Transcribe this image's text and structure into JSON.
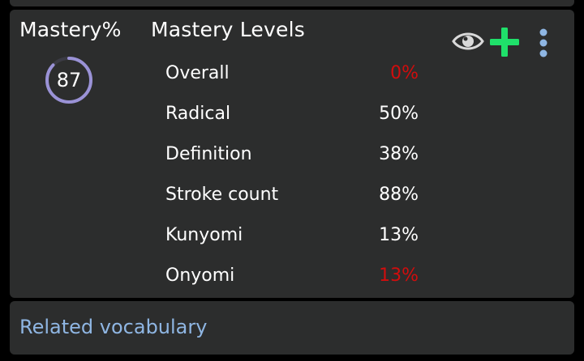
{
  "mastery": {
    "title": "Mastery%",
    "value": "87",
    "ring_fraction": 0.87,
    "ring_color": "#9a92d6"
  },
  "levels": {
    "title": "Mastery Levels",
    "items": [
      {
        "label": "Overall",
        "percent": "0%",
        "warn": true
      },
      {
        "label": "Radical",
        "percent": "50%",
        "warn": false
      },
      {
        "label": "Definition",
        "percent": "38%",
        "warn": false
      },
      {
        "label": "Stroke count",
        "percent": "88%",
        "warn": false
      },
      {
        "label": "Kunyomi",
        "percent": "13%",
        "warn": false
      },
      {
        "label": "Onyomi",
        "percent": "13%",
        "warn": true
      }
    ]
  },
  "toolbar": {
    "icons": [
      "eye-icon",
      "plus-icon",
      "more-vertical-icon"
    ],
    "plus_color": "#1fe06a",
    "more_color": "#8fb6e3",
    "eye_color": "#d9d9d9"
  },
  "footer": {
    "related_label": "Related vocabulary"
  },
  "colors": {
    "card_bg": "#2c2d2d",
    "warn": "#d10d0d",
    "link": "#8fb6e3"
  }
}
